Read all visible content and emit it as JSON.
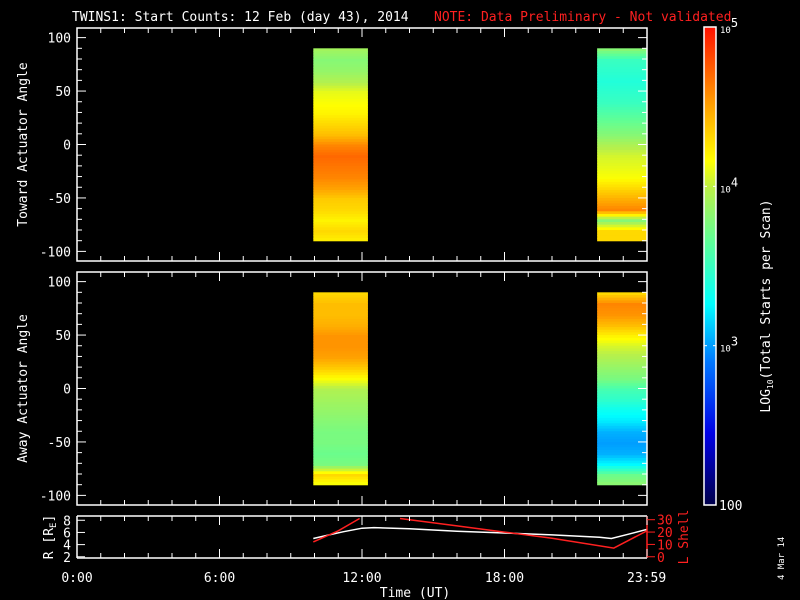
{
  "title": {
    "main": "TWINS1: Start Counts: 12 Feb (day  43), 2014",
    "note": "NOTE: Data Preliminary - Not validated",
    "note_color": "#ff2020"
  },
  "date_stamp": "4 Mar 14",
  "chart_data": [
    {
      "type": "heatmap",
      "name": "toward",
      "ylabel": "Toward Actuator Angle",
      "ylim": [
        -109,
        109
      ],
      "yticks": [
        100,
        50,
        0,
        -50,
        -100
      ],
      "xlim": [
        0,
        24
      ],
      "angles": [
        90,
        80,
        70,
        60,
        50,
        40,
        30,
        20,
        10,
        0,
        -10,
        -20,
        -30,
        -40,
        -50,
        -60,
        -70,
        -80,
        -90
      ],
      "blocks": [
        {
          "t_start": 9.95,
          "t_end": 12.25,
          "log_counts": [
            3.9,
            3.8,
            3.85,
            3.95,
            4.1,
            4.15,
            4.2,
            4.3,
            4.4,
            4.6,
            4.7,
            4.65,
            4.6,
            4.5,
            4.35,
            4.3,
            4.2,
            4.3,
            4.2
          ]
        },
        {
          "t_start": 21.9,
          "t_end": 24.0,
          "log_counts": [
            3.8,
            3.5,
            3.45,
            3.4,
            3.45,
            3.5,
            3.6,
            3.7,
            3.8,
            3.95,
            4.05,
            4.1,
            4.15,
            4.3,
            4.45,
            4.6,
            3.8,
            4.3,
            4.3
          ]
        }
      ]
    },
    {
      "type": "heatmap",
      "name": "away",
      "ylabel": "Away Actuator Angle",
      "ylim": [
        -109,
        109
      ],
      "yticks": [
        100,
        50,
        0,
        -50,
        -100
      ],
      "xlim": [
        0,
        24
      ],
      "angles": [
        90,
        80,
        70,
        60,
        50,
        40,
        30,
        20,
        10,
        0,
        -10,
        -20,
        -30,
        -40,
        -50,
        -60,
        -70,
        -80,
        -90
      ],
      "blocks": [
        {
          "t_start": 9.95,
          "t_end": 12.25,
          "log_counts": [
            4.3,
            4.4,
            4.4,
            4.45,
            4.55,
            4.55,
            4.5,
            4.35,
            4.15,
            3.95,
            3.9,
            3.85,
            3.8,
            3.75,
            3.75,
            3.7,
            3.75,
            4.3,
            4.1
          ]
        },
        {
          "t_start": 21.9,
          "t_end": 24.0,
          "log_counts": [
            4.3,
            4.6,
            4.55,
            4.4,
            4.2,
            4.05,
            3.95,
            3.85,
            3.75,
            3.55,
            3.45,
            3.3,
            3.2,
            3.05,
            3.0,
            3.05,
            3.25,
            3.7,
            3.85
          ]
        }
      ]
    },
    {
      "type": "line",
      "name": "orbit",
      "ylabel": "R [RE]",
      "ylabel_main": "R [R",
      "ylabel_sub": "E",
      "ylabel_end": "]",
      "ylim": [
        1.8,
        8.7
      ],
      "yticks": [
        8,
        6,
        4,
        2
      ],
      "y2label": "L Shell",
      "y2lim": [
        -1,
        33
      ],
      "y2ticks": [
        30,
        20,
        10,
        0
      ],
      "xlim": [
        0,
        24
      ],
      "xticks": [
        0,
        6,
        12,
        18,
        23.983
      ],
      "xtick_labels": [
        "0:00",
        "6:00",
        "12:00",
        "18:00",
        "23:59"
      ],
      "xlabel": "Time (UT)",
      "series": [
        {
          "name": "R",
          "color": "#ffffff",
          "x": [
            9.95,
            10.5,
            11.2,
            12.0,
            12.5,
            14,
            16,
            18,
            20,
            22,
            22.5,
            23.2,
            24
          ],
          "y": [
            5.0,
            5.5,
            6.1,
            6.7,
            6.8,
            6.6,
            6.2,
            5.9,
            5.6,
            5.2,
            5.0,
            5.7,
            6.5
          ]
        },
        {
          "name": "L Shell",
          "color": "#ff2020",
          "axis": "y2",
          "x": [
            9.95,
            11.0,
            11.9
          ],
          "y": [
            12,
            21,
            31
          ]
        },
        {
          "name": "L Shell (cont.)",
          "color": "#ff2020",
          "axis": "y2",
          "x": [
            13.6,
            16,
            18,
            20,
            22.6,
            24
          ],
          "y": [
            31,
            25,
            20,
            15,
            7,
            21
          ]
        }
      ]
    }
  ],
  "colorbar": {
    "label": "LOG10(Total Starts per Scan)",
    "label_pre": "LOG",
    "label_sub": "10",
    "label_post": "(Total Starts per Scan)",
    "range_log": [
      2,
      5
    ],
    "ticks": [
      {
        "log": 5,
        "base": "10",
        "exp": "5"
      },
      {
        "log": 4,
        "base": "10",
        "exp": "4"
      },
      {
        "log": 3,
        "base": "10",
        "exp": "3"
      }
    ],
    "min_label": "100",
    "stops": [
      [
        0.0,
        "#00004a"
      ],
      [
        0.15,
        "#0000e6"
      ],
      [
        0.3,
        "#0078ff"
      ],
      [
        0.42,
        "#00ffff"
      ],
      [
        0.55,
        "#5dff98"
      ],
      [
        0.66,
        "#b8f04a"
      ],
      [
        0.72,
        "#ffff00"
      ],
      [
        0.85,
        "#ff9400"
      ],
      [
        1.0,
        "#ff1000"
      ]
    ]
  }
}
